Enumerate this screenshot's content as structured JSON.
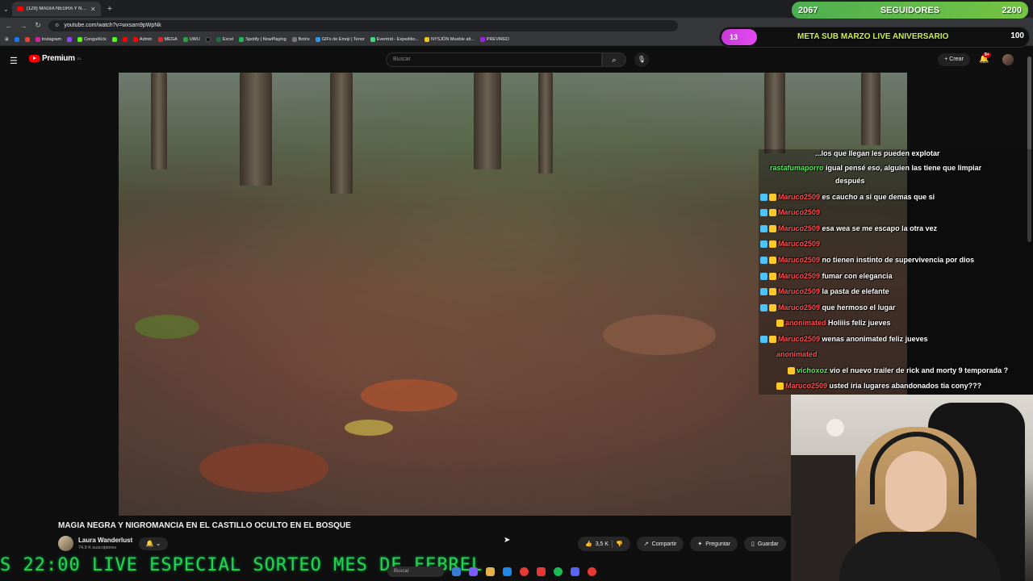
{
  "browser": {
    "tab_title": "(129) MAGIA NEGRA Y NIG...",
    "url": "youtube.com/watch?v=wxsam9pWpNk",
    "bookmarks": [
      "Instagram",
      "ConguiKick",
      "Admin",
      "MEGA",
      "UWU",
      "Excel",
      "Spotify | NowPlaying",
      "Botrix",
      "GIFs de Emoji | Tenor",
      "Eventrid - Expeditio...",
      "NYSJÖN Mueble alt...",
      "PREVIRED"
    ]
  },
  "youtube": {
    "brand": "Premium",
    "region": "CL",
    "search_placeholder": "Buscar",
    "create_label": "Crear",
    "notif_count": "9+"
  },
  "video": {
    "title": "MAGIA NEGRA Y NIGROMANCIA EN EL CASTILLO OCULTO EN EL BOSQUE",
    "channel": "Laura Wanderlust",
    "subscribers": "74,9 K suscriptores",
    "likes": "3,5 K",
    "share_label": "Compartir",
    "ask_label": "Preguntar",
    "save_label": "Guardar"
  },
  "overlay": {
    "followers_current": "2067",
    "followers_label": "SEGUIDORES",
    "followers_goal": "2200",
    "sub_count": "13",
    "sub_goal_label": "META SUB MARZO LIVE ANIVERSARIO",
    "sub_goal_max": "100",
    "ticker": "S 22:00 LIVE ESPECIAL SORTEO MES DE FEBREL"
  },
  "chat": [
    {
      "user": "",
      "text": "...los que llegan les pueden explotar",
      "color": "#ffffff"
    },
    {
      "user": "rastafumaporro",
      "text": "igual pensé eso, alguien las tiene que limpiar",
      "color": "#5ee85e"
    },
    {
      "user": "",
      "text": "después",
      "color": "#ffffff"
    },
    {
      "user": "Maruco2509",
      "text": "es caucho a si que demas que si",
      "color": "#ff4d4d"
    },
    {
      "user": "Maruco2509",
      "text": "",
      "color": "#ff4d4d"
    },
    {
      "user": "Maruco2509",
      "text": "esa wea se me escapo la otra vez",
      "color": "#ff4d4d"
    },
    {
      "user": "Maruco2509",
      "text": "",
      "color": "#ff4d4d"
    },
    {
      "user": "Maruco2509",
      "text": "no tienen instinto de supervivencia por dios",
      "color": "#ff4d4d"
    },
    {
      "user": "Maruco2509",
      "text": "fumar con elegancia",
      "color": "#ff4d4d"
    },
    {
      "user": "Maruco2509",
      "text": "la pasta de elefante",
      "color": "#ff4d4d"
    },
    {
      "user": "Maruco2509",
      "text": "que hermoso el lugar",
      "color": "#ff4d4d"
    },
    {
      "user": "anonimated",
      "text": "Holiiis feliz jueves",
      "color": "#ff4d4d"
    },
    {
      "user": "Maruco2509",
      "text": "wenas anonimated feliz jueves",
      "color": "#ff4d4d"
    },
    {
      "user": "anonimated",
      "text": "",
      "color": "#ff4d4d"
    },
    {
      "user": "vichoxoz",
      "text": "vio el nuevo trailer de rick and morty 9 temporada ?",
      "color": "#5ee85e"
    },
    {
      "user": "Maruco2509",
      "text": "usted iria lugares abandonados tia cony???",
      "color": "#ff4d4d"
    }
  ],
  "taskbar": {
    "search_placeholder": "Buscar",
    "icon_colors": [
      "#3a7bd5",
      "#7c5cff",
      "#e6b34a",
      "#1e88e5",
      "#e53935",
      "#e53935",
      "#1db954",
      "#5865f2",
      "#e53935"
    ]
  }
}
